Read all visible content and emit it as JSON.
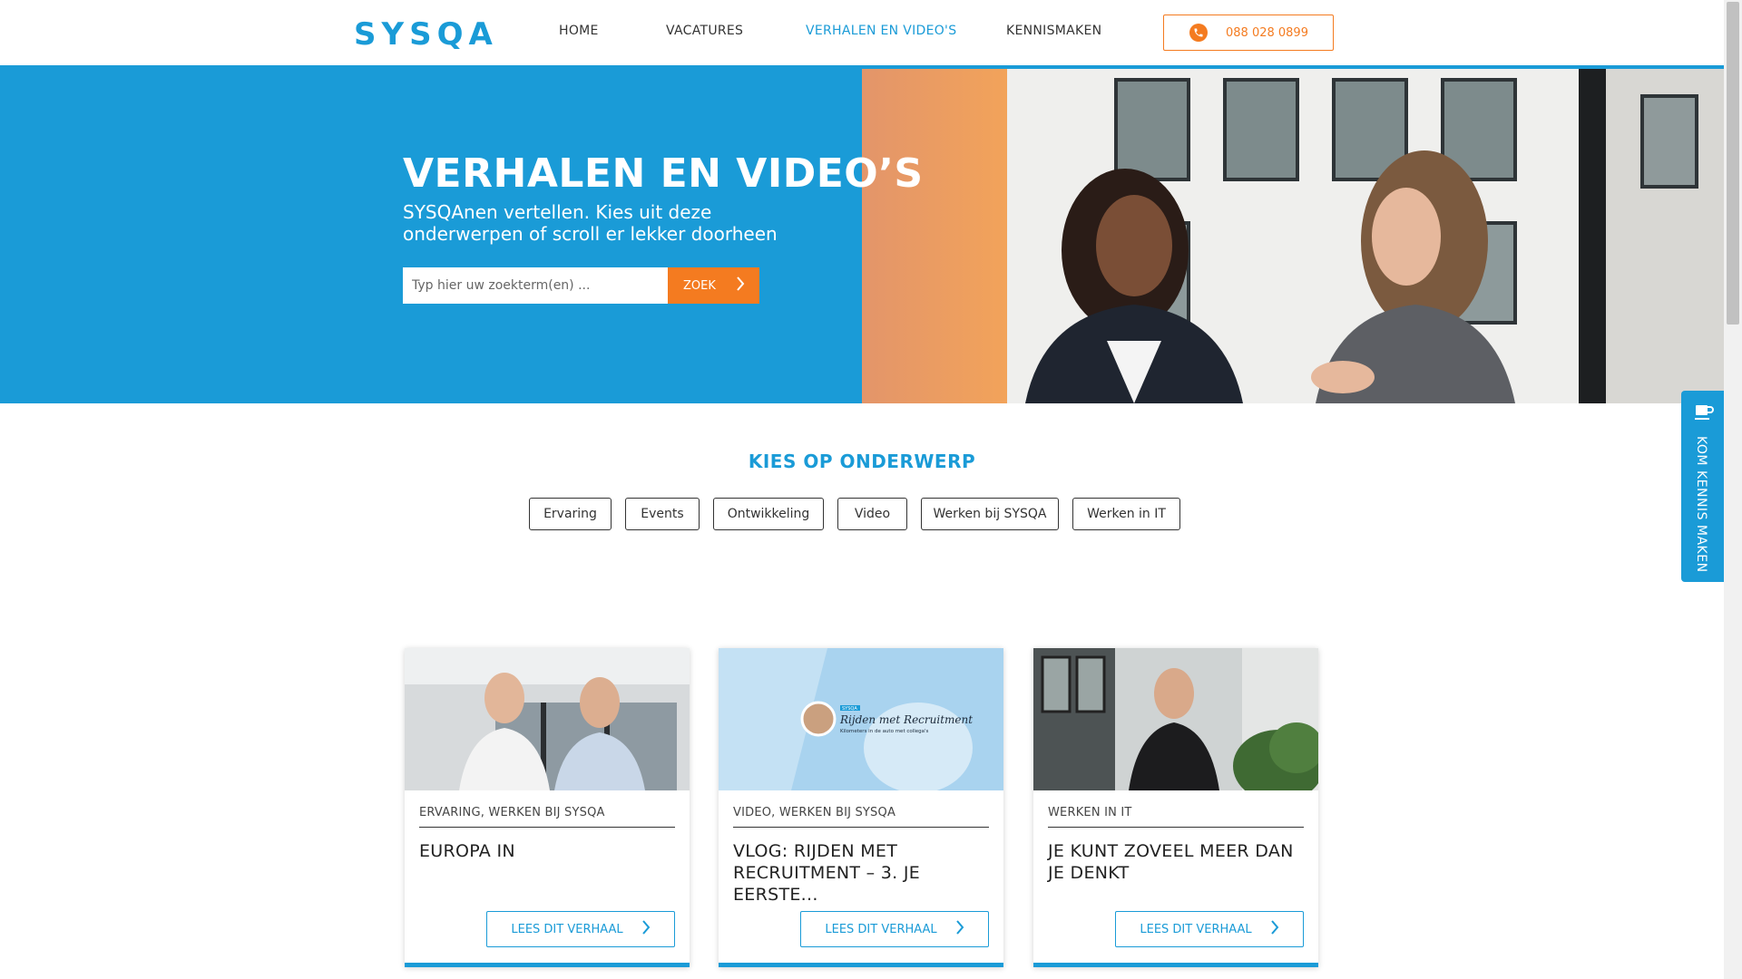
{
  "header": {
    "logo": "SYSQA",
    "nav": [
      {
        "label": "HOME"
      },
      {
        "label": "VACATURES"
      },
      {
        "label": "VERHALEN EN VIDEO'S"
      },
      {
        "label": "KENNISMAKEN"
      }
    ],
    "phone": "088 028 0899"
  },
  "hero": {
    "title": "VERHALEN EN VIDEO’S",
    "subtitle": "SYSQAnen vertellen. Kies uit deze onderwerpen of scroll er lekker doorheen",
    "search_placeholder": "Typ hier uw zoekterm(en) ...",
    "search_button": "ZOEK"
  },
  "topics": {
    "title": "KIES OP ONDERWERP",
    "items": [
      {
        "label": "Ervaring"
      },
      {
        "label": "Events"
      },
      {
        "label": "Ontwikkeling"
      },
      {
        "label": "Video"
      },
      {
        "label": "Werken bij SYSQA"
      },
      {
        "label": "Werken in IT"
      }
    ]
  },
  "cards": [
    {
      "category": "ERVARING, WERKEN BIJ SYSQA",
      "title": "EUROPA IN",
      "button": "LEES DIT VERHAAL"
    },
    {
      "category": "VIDEO, WERKEN BIJ SYSQA",
      "title": "VLOG: RIJDEN MET RECRUITMENT – 3. JE EERSTE...",
      "button": "LEES DIT VERHAAL",
      "image_text": {
        "badge": "SYSQA",
        "title": "Rijden met Recruitment",
        "tagline": "Kilometers in de auto met collega's"
      }
    },
    {
      "category": "WERKEN IN IT",
      "title": "JE KUNT ZOVEEL MEER DAN JE DENKT",
      "button": "LEES DIT VERHAAL"
    }
  ],
  "side_tab": {
    "label": "KOM KENNIS MAKEN"
  },
  "colors": {
    "brand_blue": "#1a9bd7",
    "accent_orange": "#f47b20"
  },
  "icons": {
    "phone": "phone-icon",
    "search_button": "chevron-right-icon",
    "card_button": "chevron-right-icon",
    "side_tab": "coffee-cup-icon"
  }
}
